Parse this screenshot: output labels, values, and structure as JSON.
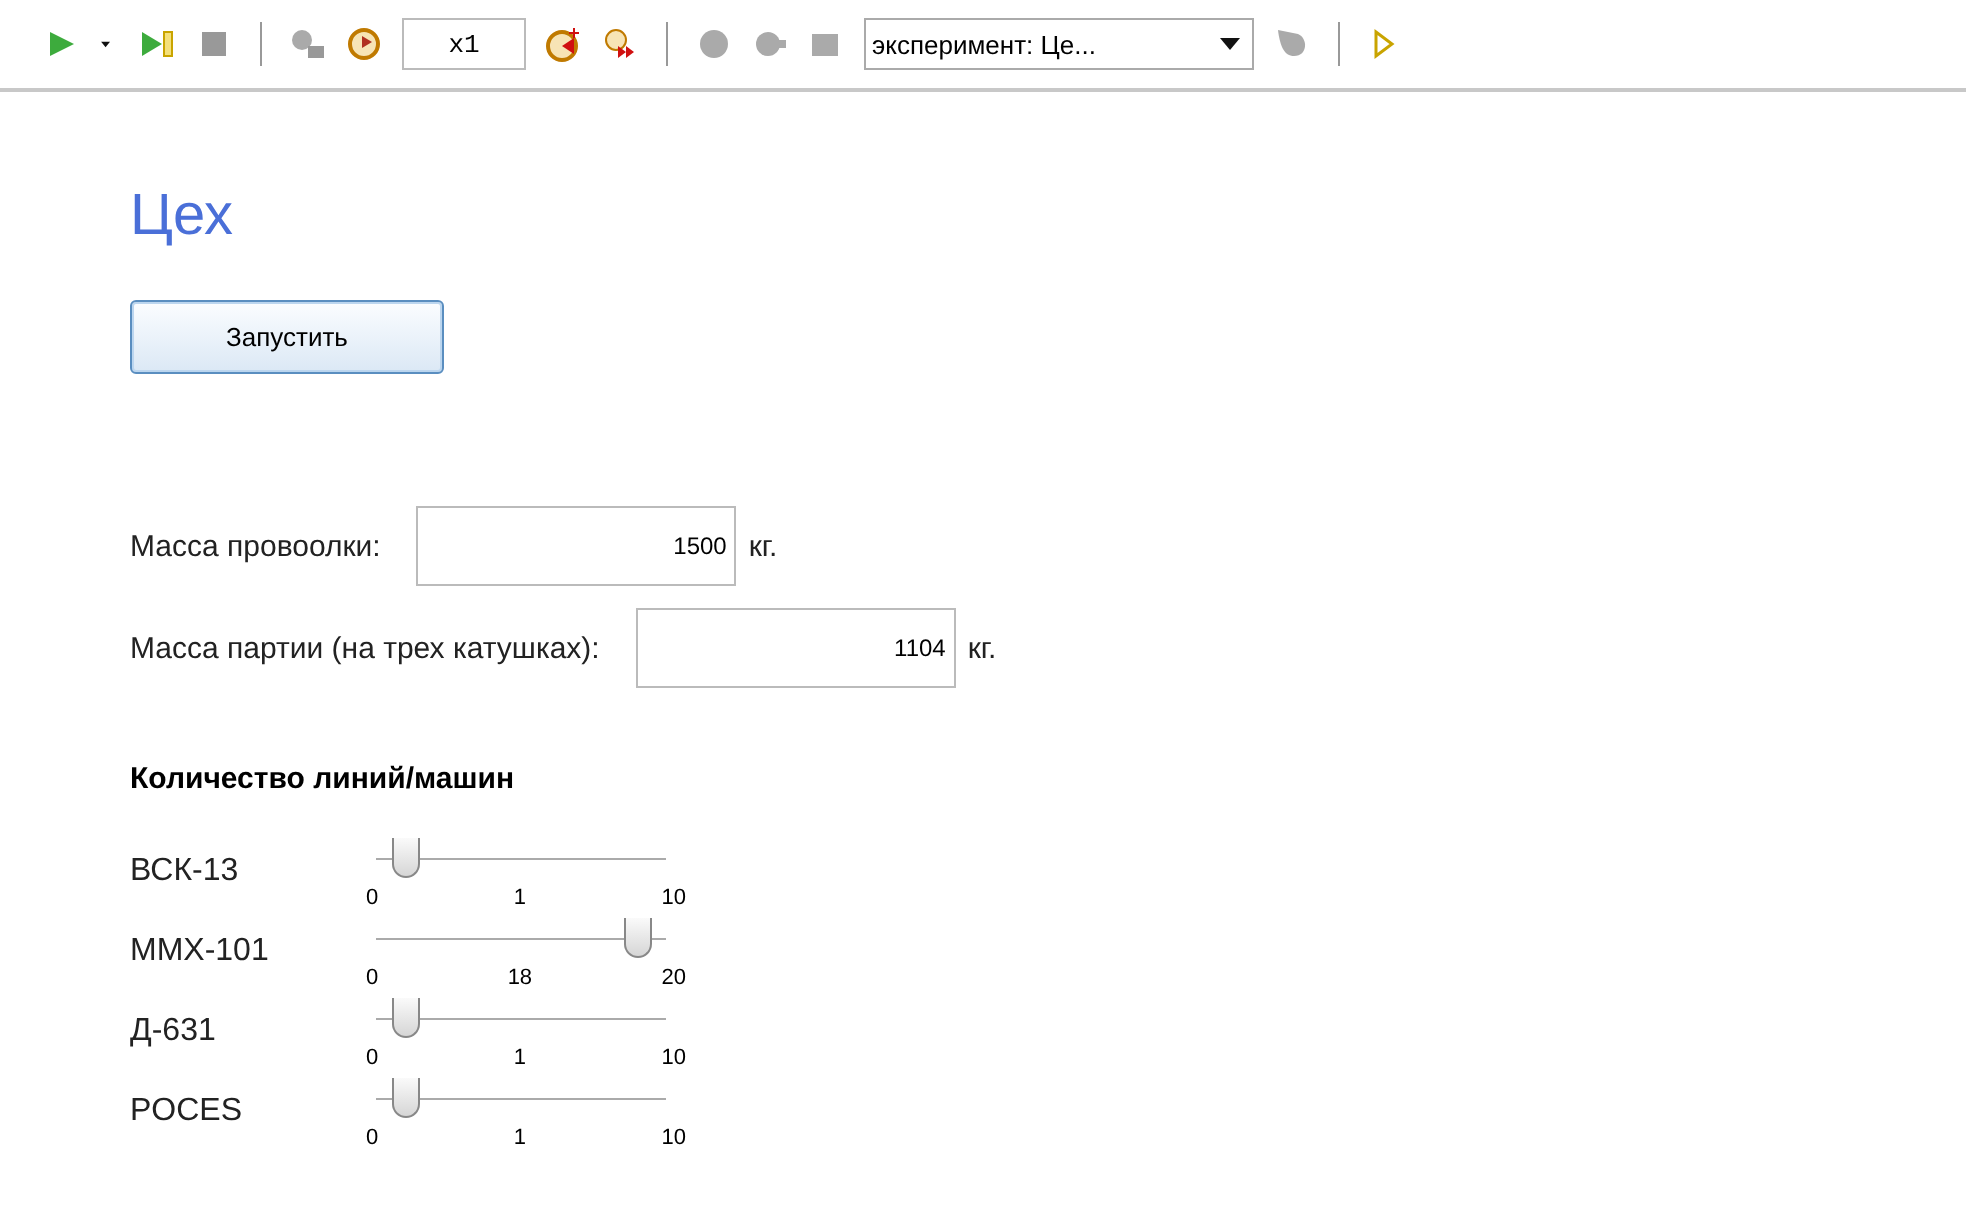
{
  "toolbar": {
    "speed": "x1",
    "experiment": "эксперимент: Це..."
  },
  "title": "Цех",
  "run_button": "Запустить",
  "fields": [
    {
      "label": "Масса провоолки:",
      "value": "1500",
      "unit": "кг."
    },
    {
      "label": "Масса партии (на трех катушках):",
      "value": "1104",
      "unit": "кг."
    }
  ],
  "section_heading": "Количество линий/машин",
  "sliders": [
    {
      "label": "ВСК-13",
      "min": "0",
      "current": "1",
      "max": "10",
      "level": 0.1
    },
    {
      "label": "ММХ-101",
      "min": "0",
      "current": "18",
      "max": "20",
      "level": 0.9
    },
    {
      "label": "Д-631",
      "min": "0",
      "current": "1",
      "max": "10",
      "level": 0.1
    },
    {
      "label": "POCES",
      "min": "0",
      "current": "1",
      "max": "10",
      "level": 0.1
    }
  ]
}
